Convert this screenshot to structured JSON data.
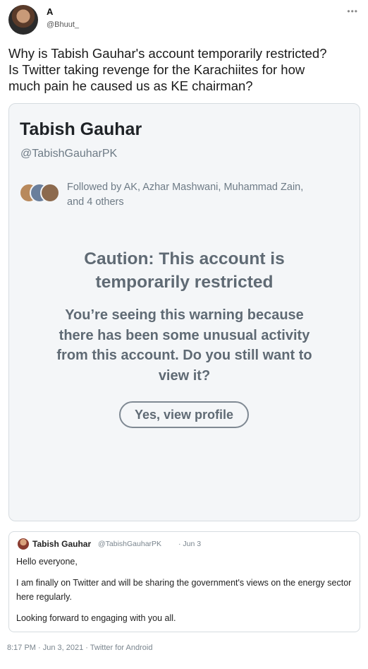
{
  "tweet": {
    "display_name": "A",
    "handle": "@Bhuut_",
    "more_icon": "more-horizontal-icon",
    "more_glyph": "•••",
    "text_lines": [
      "Why is Tabish Gauhar's account temporarily restricted?",
      "Is Twitter taking revenge for the Karachiites for how",
      "much pain he caused us as KE chairman?"
    ],
    "timestamp": "8:17 PM · Jun 3, 2021 · Twitter for Android"
  },
  "screenshot_card": {
    "profile_name": "Tabish Gauhar",
    "profile_handle": "@TabishGauharPK",
    "followed_by_line1": "Followed by AK, Azhar Mashwani, Muhammad Zain,",
    "followed_by_line2": "and 4 others",
    "caution_title_line1": "Caution: This account is",
    "caution_title_line2": "temporarily restricted",
    "caution_body_line1": "You’re seeing this warning because",
    "caution_body_line2": "there has been some unusual activity",
    "caution_body_line3": "from this account. Do you still want to",
    "caution_body_line4": "view it?",
    "view_button_label": "Yes, view profile"
  },
  "quoted_tweet": {
    "name": "Tabish Gauhar",
    "handle": "@TabishGauharPK",
    "date": "· Jun 3",
    "paragraphs": [
      "Hello everyone,",
      "I am finally on Twitter and will be sharing the government's views on the energy sector here regularly.",
      "Looking forward to engaging with you all."
    ]
  }
}
